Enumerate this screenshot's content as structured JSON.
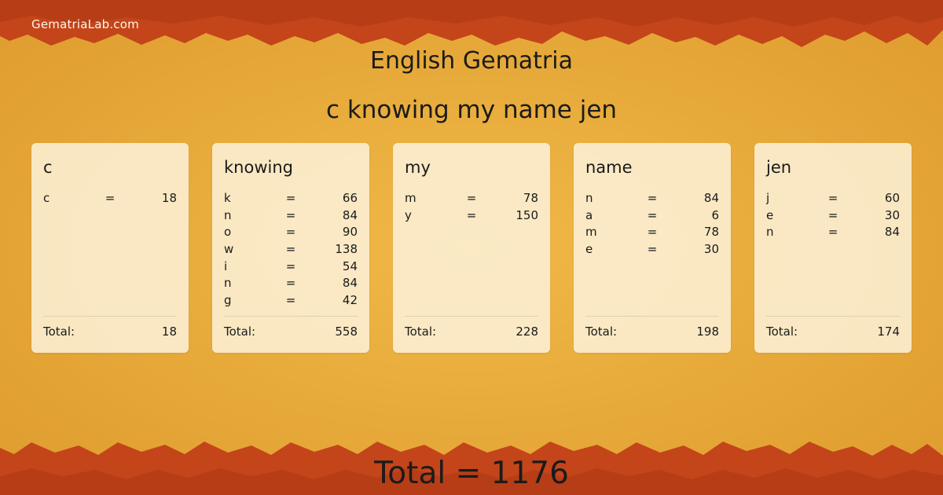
{
  "site": "GematriaLab.com",
  "heading": "English Gematria",
  "phrase": "c knowing my name jen",
  "colors": {
    "background": "#e9ab3a",
    "border": "#c74a14",
    "card": "#fcf0d6"
  },
  "total_label": "Total:",
  "equals": "=",
  "words": [
    {
      "word": "c",
      "letters": [
        {
          "ch": "c",
          "val": "18"
        }
      ],
      "total": "18"
    },
    {
      "word": "knowing",
      "letters": [
        {
          "ch": "k",
          "val": "66"
        },
        {
          "ch": "n",
          "val": "84"
        },
        {
          "ch": "o",
          "val": "90"
        },
        {
          "ch": "w",
          "val": "138"
        },
        {
          "ch": "i",
          "val": "54"
        },
        {
          "ch": "n",
          "val": "84"
        },
        {
          "ch": "g",
          "val": "42"
        }
      ],
      "total": "558"
    },
    {
      "word": "my",
      "letters": [
        {
          "ch": "m",
          "val": "78"
        },
        {
          "ch": "y",
          "val": "150"
        }
      ],
      "total": "228"
    },
    {
      "word": "name",
      "letters": [
        {
          "ch": "n",
          "val": "84"
        },
        {
          "ch": "a",
          "val": "6"
        },
        {
          "ch": "m",
          "val": "78"
        },
        {
          "ch": "e",
          "val": "30"
        }
      ],
      "total": "198"
    },
    {
      "word": "jen",
      "letters": [
        {
          "ch": "j",
          "val": "60"
        },
        {
          "ch": "e",
          "val": "30"
        },
        {
          "ch": "n",
          "val": "84"
        }
      ],
      "total": "174"
    }
  ],
  "grand_total": "Total = 1176"
}
